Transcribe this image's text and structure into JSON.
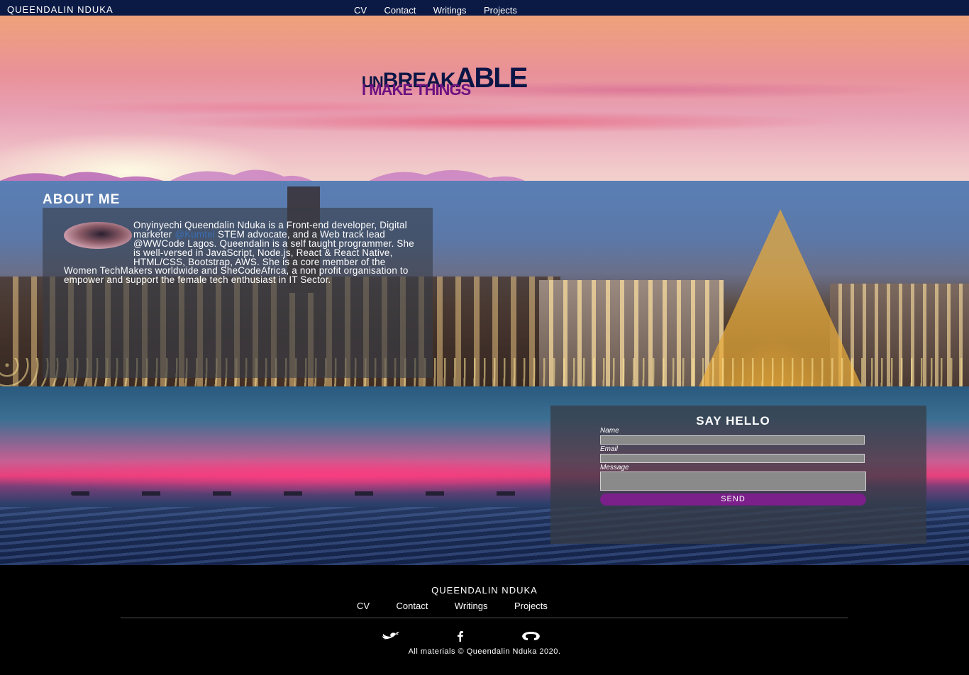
{
  "nav": {
    "brand": "QUEENDALIN NDUKA",
    "links": [
      "CV",
      "Contact",
      "Writings",
      "Projects"
    ]
  },
  "hero": {
    "title_small": "UN",
    "title_mid": "BREAK",
    "title_big": "ABLE",
    "subtitle": "I MAKE THINGS"
  },
  "about": {
    "heading": "ABOUT ME",
    "text_before_link": "Onyinyechi Queendalin Nduka is a Front-end developer, Digital marketer ",
    "link_text": "@Kumtel",
    "text_after_link": " STEM advocate, and a Web track lead @WWCode Lagos. Queendalin is a self taught programmer. She is well-versed in JavaScript, Node.js, React & React Native, HTML/CSS, Bootstrap, AWS. She is a core member of the Women TechMakers worldwide and SheCodeAfrica, a non profit organisation to empower and support the female tech enthusiast in IT Sector."
  },
  "contact": {
    "heading": "SAY HELLO",
    "name_label": "Name",
    "email_label": "Email",
    "message_label": "Message",
    "send_label": "SEND"
  },
  "footer": {
    "brand": "QUEENDALIN NDUKA",
    "links": [
      "CV",
      "Contact",
      "Writings",
      "Projects"
    ],
    "social_icons": [
      "twitter-icon",
      "facebook-icon",
      "github-icon"
    ],
    "copyright": "All materials © Queendalin Nduka 2020."
  },
  "colors": {
    "nav_bg": "#0b1a45",
    "accent": "#7b1f8a",
    "hero_title": "#0c1646",
    "hero_subtitle": "#6a1280",
    "link": "#3a6db4"
  }
}
